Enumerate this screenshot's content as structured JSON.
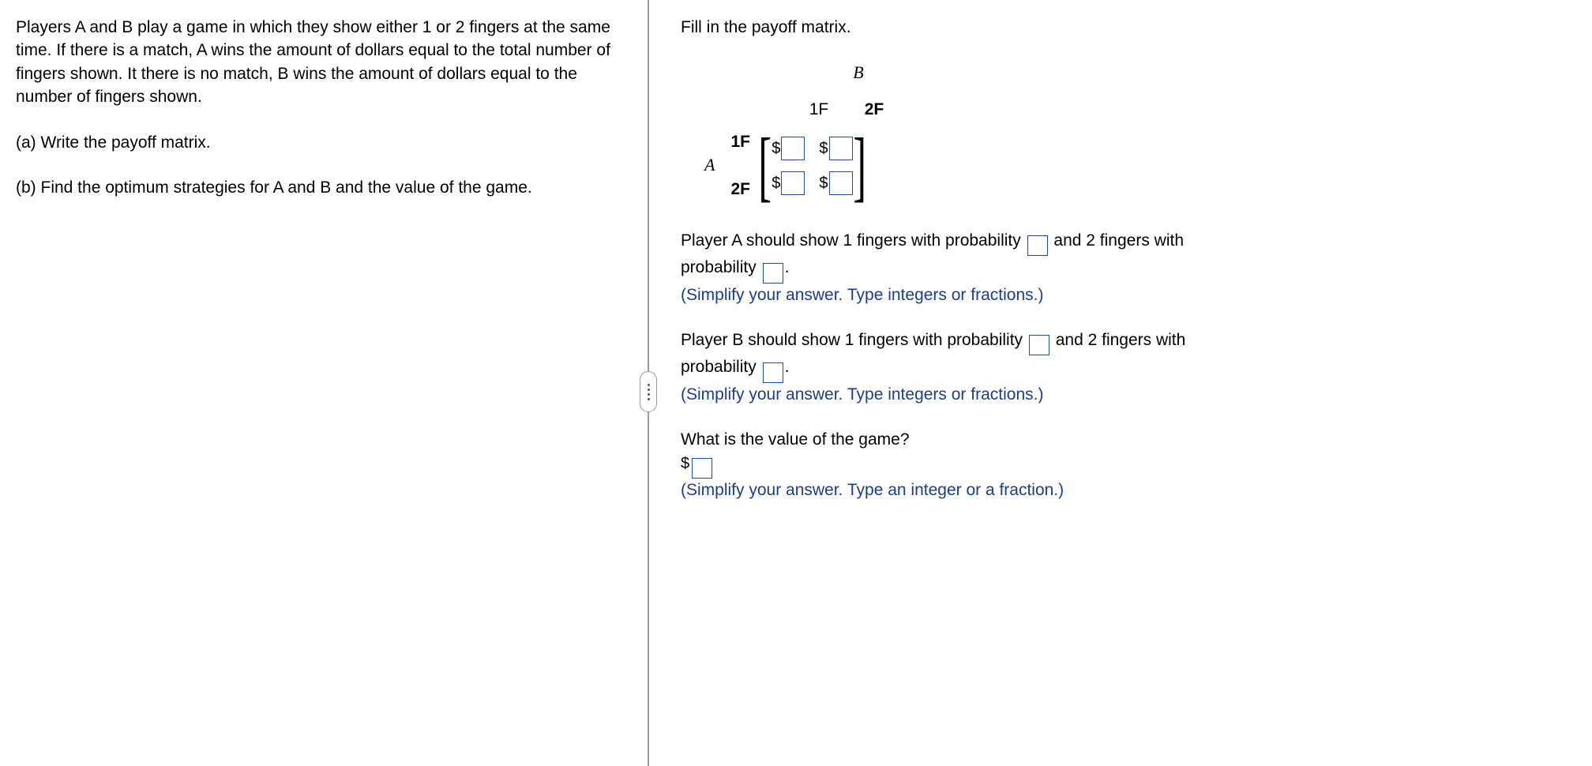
{
  "left": {
    "intro": "Players A and B play a game in which they show either 1 or 2 fingers at the same time.  If there is a match, A wins the amount of dollars equal to the total number of fingers shown.  It there is no match, B wins the amount of dollars equal to the number of fingers shown.",
    "partA": "(a) Write the payoff matrix.",
    "partB": "(b) Find the optimum strategies for A and B and the value of the game."
  },
  "right": {
    "fillIn": "Fill in the payoff matrix.",
    "labelB": "B",
    "labelA": "A",
    "col1": "1F",
    "col2": "2F",
    "row1": "1F",
    "row2": "2F",
    "dollar": "$",
    "playerA_line1a": "Player A should show 1 fingers with probability ",
    "playerA_line1b": " and 2 fingers with",
    "probability_word": "probability ",
    "period": ".",
    "hint1": "(Simplify your answer. Type integers or fractions.)",
    "playerB_line1a": "Player B should show 1 fingers with probability ",
    "playerB_line1b": " and 2 fingers with",
    "valueQ": "What is the value of the game?",
    "hint2": "(Simplify your answer. Type an integer or a fraction.)"
  }
}
